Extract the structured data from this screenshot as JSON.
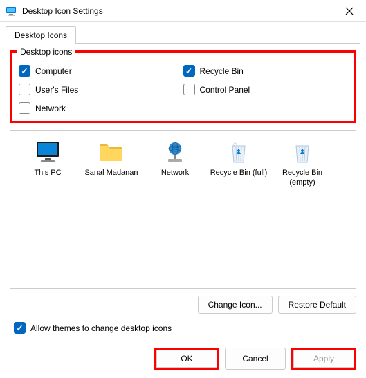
{
  "titlebar": {
    "title": "Desktop Icon Settings"
  },
  "tabs": {
    "active": "Desktop Icons"
  },
  "group": {
    "legend": "Desktop icons",
    "items": [
      {
        "label": "Computer",
        "checked": true
      },
      {
        "label": "Recycle Bin",
        "checked": true
      },
      {
        "label": "User's Files",
        "checked": false
      },
      {
        "label": "Control Panel",
        "checked": false
      },
      {
        "label": "Network",
        "checked": false
      }
    ]
  },
  "preview": [
    {
      "label": "This PC",
      "icon": "monitor"
    },
    {
      "label": "Sanal Madanan",
      "icon": "folder"
    },
    {
      "label": "Network",
      "icon": "network"
    },
    {
      "label": "Recycle Bin (full)",
      "icon": "bin-full"
    },
    {
      "label": "Recycle Bin (empty)",
      "icon": "bin-empty"
    }
  ],
  "buttons": {
    "changeIcon": "Change Icon...",
    "restoreDefault": "Restore Default",
    "ok": "OK",
    "cancel": "Cancel",
    "apply": "Apply"
  },
  "allowThemes": {
    "label": "Allow themes to change desktop icons",
    "checked": true
  }
}
